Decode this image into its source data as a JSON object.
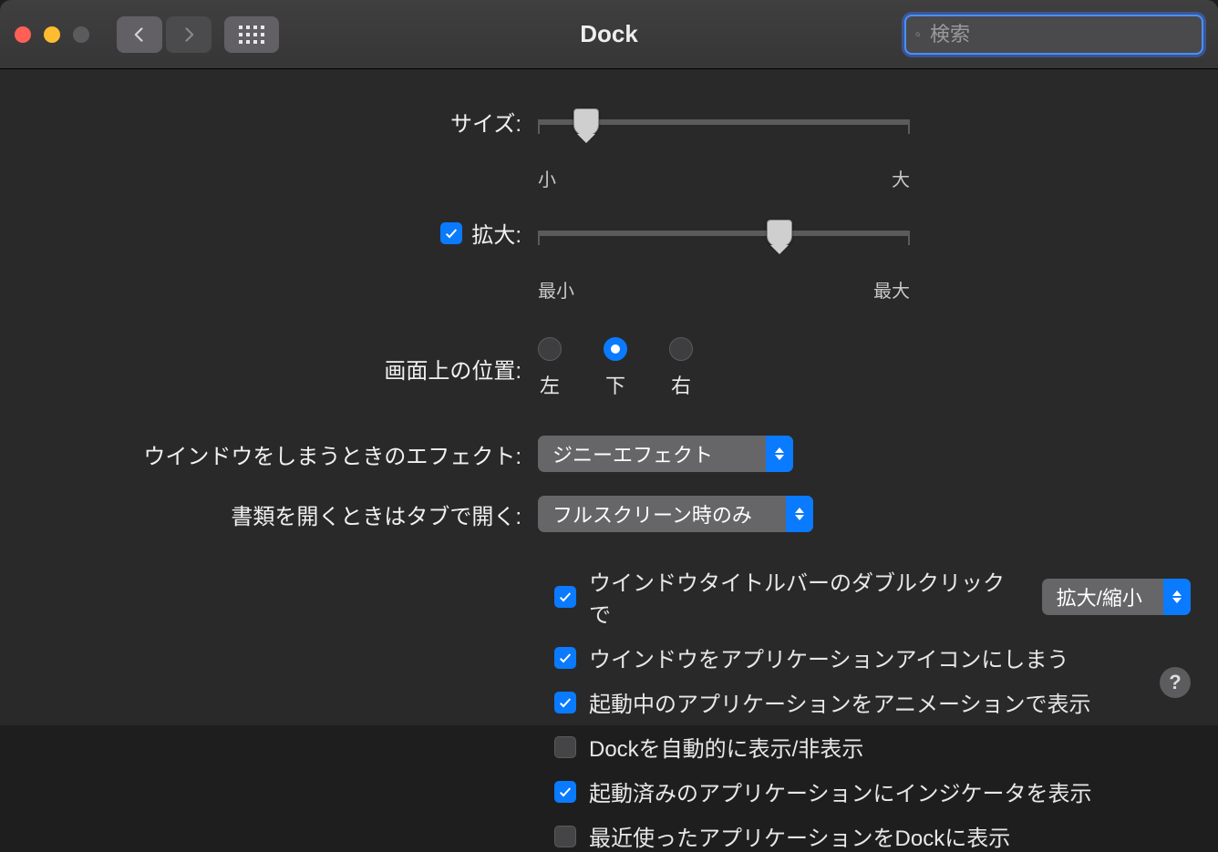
{
  "window": {
    "title": "Dock",
    "search_placeholder": "検索"
  },
  "colors": {
    "accent": "#0a7aff"
  },
  "sliders": {
    "size": {
      "label": "サイズ:",
      "min_label": "小",
      "max_label": "大",
      "value_pct": 13
    },
    "magnify": {
      "checkbox_checked": true,
      "label": "拡大:",
      "min_label": "最小",
      "max_label": "最大",
      "value_pct": 65
    }
  },
  "position": {
    "label": "画面上の位置:",
    "options": [
      {
        "id": "left",
        "label": "左",
        "selected": false
      },
      {
        "id": "bottom",
        "label": "下",
        "selected": true
      },
      {
        "id": "right",
        "label": "右",
        "selected": false
      }
    ]
  },
  "dropdowns": {
    "minimize_effect": {
      "label": "ウインドウをしまうときのエフェクト:",
      "value": "ジニーエフェクト"
    },
    "open_in_tab": {
      "label": "書類を開くときはタブで開く:",
      "value": "フルスクリーン時のみ"
    },
    "dblclick_action": {
      "value": "拡大/縮小"
    }
  },
  "checks": {
    "dblclick": {
      "checked": true,
      "label": "ウインドウタイトルバーのダブルクリックで"
    },
    "minimize_into": {
      "checked": true,
      "label": "ウインドウをアプリケーションアイコンにしまう"
    },
    "animate_open": {
      "checked": true,
      "label": "起動中のアプリケーションをアニメーションで表示"
    },
    "autohide": {
      "checked": false,
      "label": "Dockを自動的に表示/非表示"
    },
    "indicators": {
      "checked": true,
      "label": "起動済みのアプリケーションにインジケータを表示"
    },
    "recent": {
      "checked": false,
      "label": "最近使ったアプリケーションをDockに表示"
    }
  }
}
